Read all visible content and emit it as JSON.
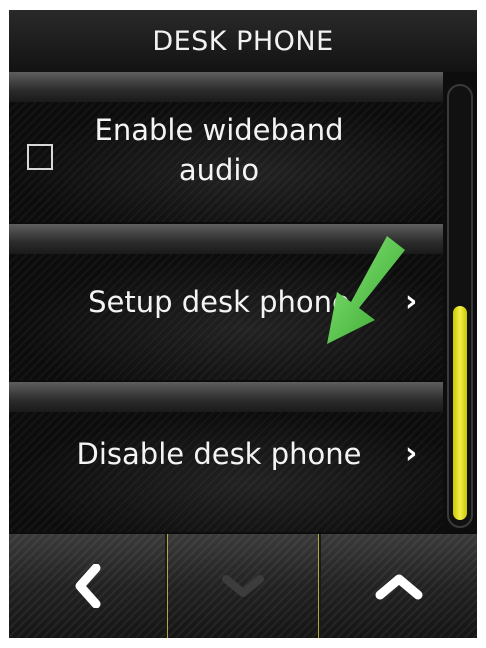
{
  "header": {
    "title": "DESK PHONE"
  },
  "list": {
    "items": [
      {
        "label_line1": "Enable wideband",
        "label_line2": "audio",
        "has_checkbox": true,
        "checked": false
      },
      {
        "label": "Setup desk phone",
        "chevron": "›"
      },
      {
        "label": "Disable desk phone",
        "chevron": "›"
      }
    ]
  },
  "scrollbar": {
    "position_fraction": 0.55
  },
  "nav": {
    "back_icon": "chevron-left-icon",
    "down_icon": "chevron-down-icon",
    "up_icon": "chevron-up-icon"
  },
  "colors": {
    "accent": "#e8e440",
    "annotation_arrow": "#4cc73c"
  }
}
